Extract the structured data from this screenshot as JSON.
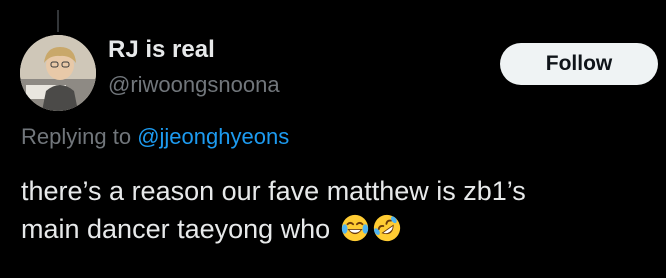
{
  "author": {
    "display_name": "RJ is real",
    "handle": "@riwoongsnoona"
  },
  "follow_button": {
    "label": "Follow"
  },
  "reply_context": {
    "prefix": "Replying to",
    "mention": "@jjeonghyeons"
  },
  "tweet": {
    "line1": "there’s a reason our fave matthew is zb1’s",
    "line2": "main dancer taeyong who",
    "emojis": [
      "face-with-tears-of-joy-icon",
      "rolling-on-floor-laughing-icon"
    ]
  },
  "colors": {
    "background": "#000000",
    "primary_text": "#e7e9ea",
    "secondary_text": "#71767b",
    "link": "#1d9bf0",
    "button_bg": "#eff3f4",
    "button_text": "#0f1419"
  }
}
